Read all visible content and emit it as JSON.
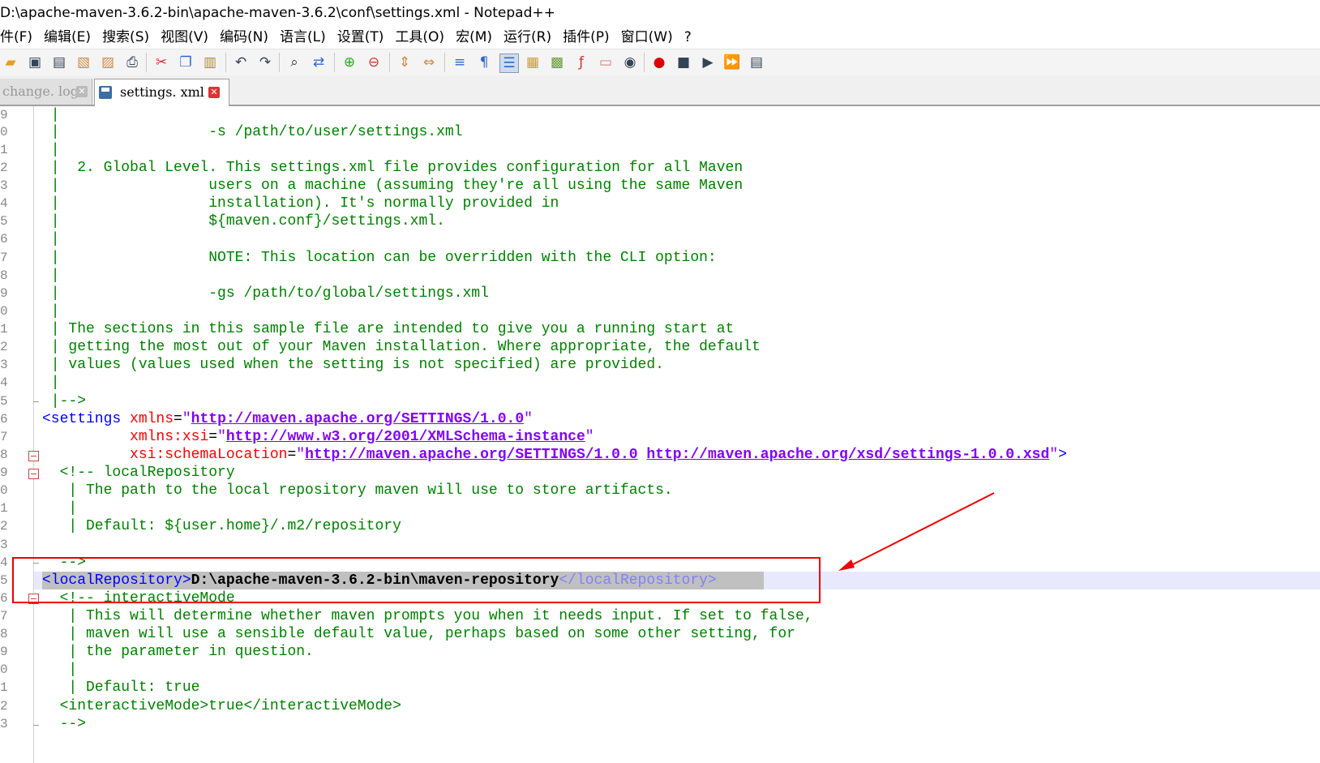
{
  "window": {
    "title": "D:\\apache-maven-3.6.2-bin\\apache-maven-3.6.2\\conf\\settings.xml - Notepad++"
  },
  "menu": [
    "件(F)",
    "编辑(E)",
    "搜索(S)",
    "视图(V)",
    "编码(N)",
    "语言(L)",
    "设置(T)",
    "工具(O)",
    "宏(M)",
    "运行(R)",
    "插件(P)",
    "窗口(W)",
    "?"
  ],
  "toolbar_icons": [
    "new-file-icon",
    "open-file-icon",
    "save-icon",
    "save-all-icon",
    "close-icon",
    "close-all-icon",
    "print-icon",
    "cut-icon",
    "copy-icon",
    "paste-icon",
    "undo-icon",
    "redo-icon",
    "find-icon",
    "replace-icon",
    "zoom-in-icon",
    "zoom-out-icon",
    "sync-v-icon",
    "sync-h-icon",
    "word-wrap-icon",
    "show-all-chars-icon",
    "indent-guide-icon",
    "user-lang-icon",
    "doc-map-icon",
    "function-list-icon",
    "folder-workspace-icon",
    "monitor-icon",
    "record-macro-icon",
    "stop-macro-icon",
    "play-macro-icon",
    "run-macro-multiple-icon",
    "save-macro-icon"
  ],
  "tabs": [
    {
      "label": "change. log",
      "active": false
    },
    {
      "label": "settings. xml",
      "active": true
    }
  ],
  "line_numbers": [
    "9",
    "0",
    "1",
    "2",
    "3",
    "4",
    "5",
    "6",
    "7",
    "8",
    "9",
    "0",
    "1",
    "2",
    "3",
    "4",
    "5",
    "6",
    "7",
    "8",
    "9",
    "0",
    "1",
    "2",
    "3",
    "4",
    "5",
    "6",
    "7",
    "8",
    "9",
    "0",
    "1",
    "2",
    "3"
  ],
  "code": {
    "l0": " |",
    "l1": " |                 -s /path/to/user/settings.xml",
    "l2": " |",
    "l3": " |  2. Global Level. This settings.xml file provides configuration for all Maven",
    "l4": " |                 users on a machine (assuming they're all using the same Maven",
    "l5": " |                 installation). It's normally provided in",
    "l6": " |                 ${maven.conf}/settings.xml.",
    "l7": " |",
    "l8": " |                 NOTE: This location can be overridden with the CLI option:",
    "l9": " |",
    "l10": " |                 -gs /path/to/global/settings.xml",
    "l11": " |",
    "l12": " | The sections in this sample file are intended to give you a running start at",
    "l13": " | getting the most out of your Maven installation. Where appropriate, the default",
    "l14": " | values (values used when the setting is not specified) are provided.",
    "l15": " |",
    "l16": " |-->",
    "l17_tag": "<settings",
    "l17_attr": "xmlns",
    "l17_url": "http://maven.apache.org/SETTINGS/1.0.0",
    "l18_attr": "xmlns:xsi",
    "l18_url": "http://www.w3.org/2001/XMLSchema-instance",
    "l19_attr": "xsi:schemaLocation",
    "l19_url1": "http://maven.apache.org/SETTINGS/1.0.0",
    "l19_url2": "http://maven.apache.org/xsd/settings-1.0.0.xsd",
    "l20": "  <!-- localRepository",
    "l21": "   | The path to the local repository maven will use to store artifacts.",
    "l22": "   |",
    "l23": "   | Default: ${user.home}/.m2/repository",
    "l24": "",
    "l25": "  -->",
    "l26_open": "<localRepository>",
    "l26_value": "D:\\apache-maven-3.6.2-bin\\maven-repository",
    "l26_close": "</localRepository>",
    "l27": "  <!-- interactiveMode",
    "l28": "   | This will determine whether maven prompts you when it needs input. If set to false,",
    "l29": "   | maven will use a sensible default value, perhaps based on some other setting, for",
    "l30": "   | the parameter in question.",
    "l31": "   |",
    "l32": "   | Default: true",
    "l33": "  <interactiveMode>true</interactiveMode>",
    "l34": "  -->"
  }
}
